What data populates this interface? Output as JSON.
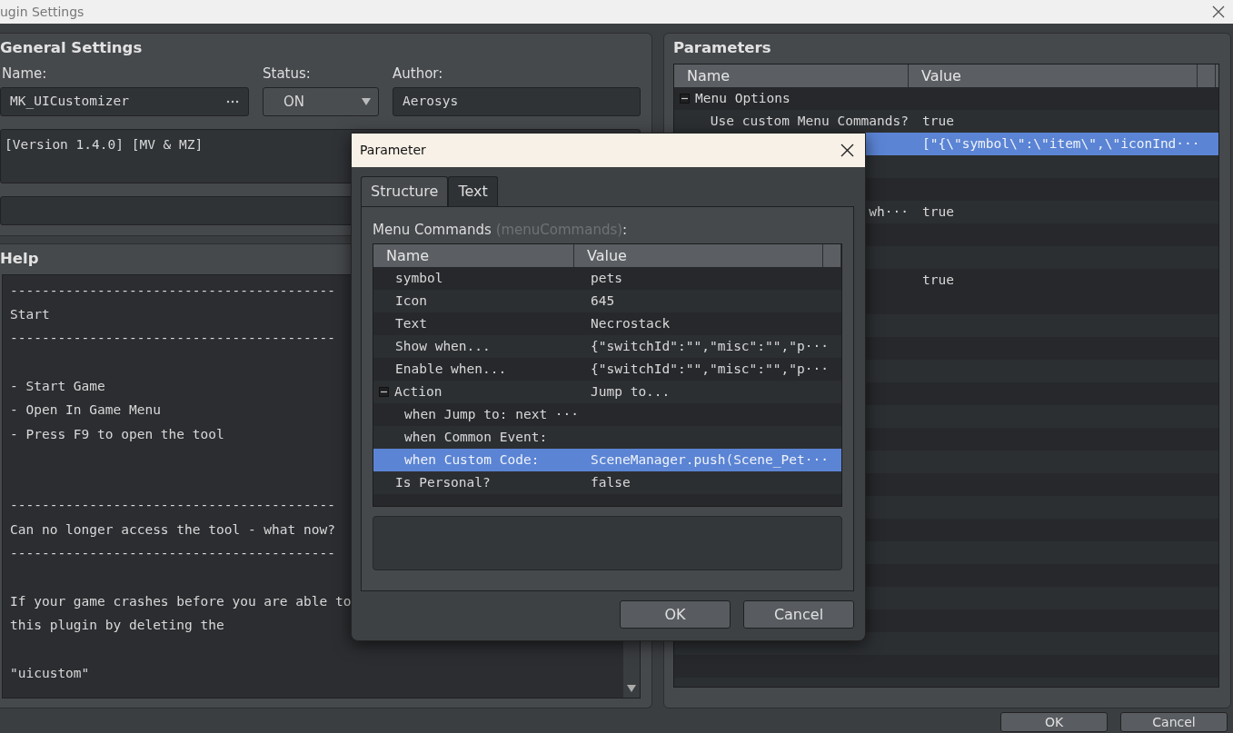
{
  "window": {
    "title": "ugin Settings"
  },
  "general": {
    "heading": "General Settings",
    "name_label": "Name:",
    "name_value": "MK_UICustomizer",
    "status_label": "Status:",
    "status_value": "ON",
    "author_label": "Author:",
    "author_value": "Aerosys",
    "description": "[Version 1.4.0] [MV & MZ]"
  },
  "help": {
    "heading": "Help",
    "lines": [
      {
        "text": "-----------------------------------------",
        "kind": "line"
      },
      {
        "text": "Start",
        "kind": "line"
      },
      {
        "text": "-----------------------------------------",
        "kind": "line"
      },
      {
        "text": "- Start Game",
        "kind": "after-gap"
      },
      {
        "text": "- Open In Game Menu",
        "kind": "line"
      },
      {
        "text": "- Press F9 to open the tool",
        "kind": "line"
      },
      {
        "text": "-----------------------------------------",
        "kind": "after-double-gap"
      },
      {
        "text": "Can no longer access the tool - what now?",
        "kind": "line"
      },
      {
        "text": "-----------------------------------------",
        "kind": "line"
      },
      {
        "text": "If your game crashes before you are able to",
        "kind": "after-gap"
      },
      {
        "text": "this plugin by deleting the",
        "kind": "line"
      },
      {
        "text": "\"uicustom\"",
        "kind": "after-gap"
      }
    ]
  },
  "parameters": {
    "heading": "Parameters",
    "columns": [
      "Name",
      "Value"
    ],
    "rows": [
      {
        "name": "Menu Options",
        "value": "",
        "kind": "group",
        "expanded": true,
        "selected": false
      },
      {
        "name": "Use custom Menu Commands?",
        "value": "true",
        "kind": "leaf",
        "selected": false
      },
      {
        "name": "",
        "value": "[\"{\\\"symbol\\\":\\\"item\\\",\\\"iconInd···",
        "kind": "leaf",
        "selected": true
      },
      {
        "name": "",
        "value": "",
        "kind": "leaf",
        "selected": false
      },
      {
        "name": "",
        "value": "",
        "kind": "leaf",
        "selected": false
      },
      {
        "name": "wh···",
        "value": "true",
        "kind": "leaf",
        "selected": false
      },
      {
        "name": "",
        "value": "",
        "kind": "leaf",
        "selected": false
      },
      {
        "name": "",
        "value": "",
        "kind": "leaf",
        "selected": false
      },
      {
        "name": "",
        "value": "true",
        "kind": "leaf",
        "selected": false
      }
    ]
  },
  "buttons": [
    "OK",
    "Cancel"
  ],
  "dialog": {
    "title": "Parameter",
    "tabs": [
      {
        "label": "Structure",
        "selected": true
      },
      {
        "label": "Text",
        "selected": false
      }
    ],
    "field_label": "Menu Commands",
    "field_key": "(menuCommands)",
    "field_suffix": ":",
    "columns": [
      "Name",
      "Value"
    ],
    "rows": [
      {
        "name": "symbol",
        "value": "pets",
        "selected": false
      },
      {
        "name": "Icon",
        "value": "645",
        "selected": false
      },
      {
        "name": "Text",
        "value": "Necrostack",
        "selected": false
      },
      {
        "name": "Show when...",
        "value": "{\"switchId\":\"\",\"misc\":\"\",\"p···",
        "selected": false
      },
      {
        "name": "Enable when...",
        "value": "{\"switchId\":\"\",\"misc\":\"\",\"p···",
        "selected": false
      },
      {
        "name": "Action",
        "value": "Jump to...",
        "selected": false,
        "expanded": true,
        "children": [
          {
            "name": "when Jump to: next ···",
            "selected": false
          },
          {
            "name": "when Common Event:",
            "selected": false
          },
          {
            "name": "when Custom Code:",
            "value": "SceneManager.push(Scene_Pet···",
            "selected": true
          }
        ]
      },
      {
        "name": "Is Personal?",
        "value": "false",
        "selected": false
      }
    ],
    "buttons": [
      "OK",
      "Cancel"
    ]
  }
}
